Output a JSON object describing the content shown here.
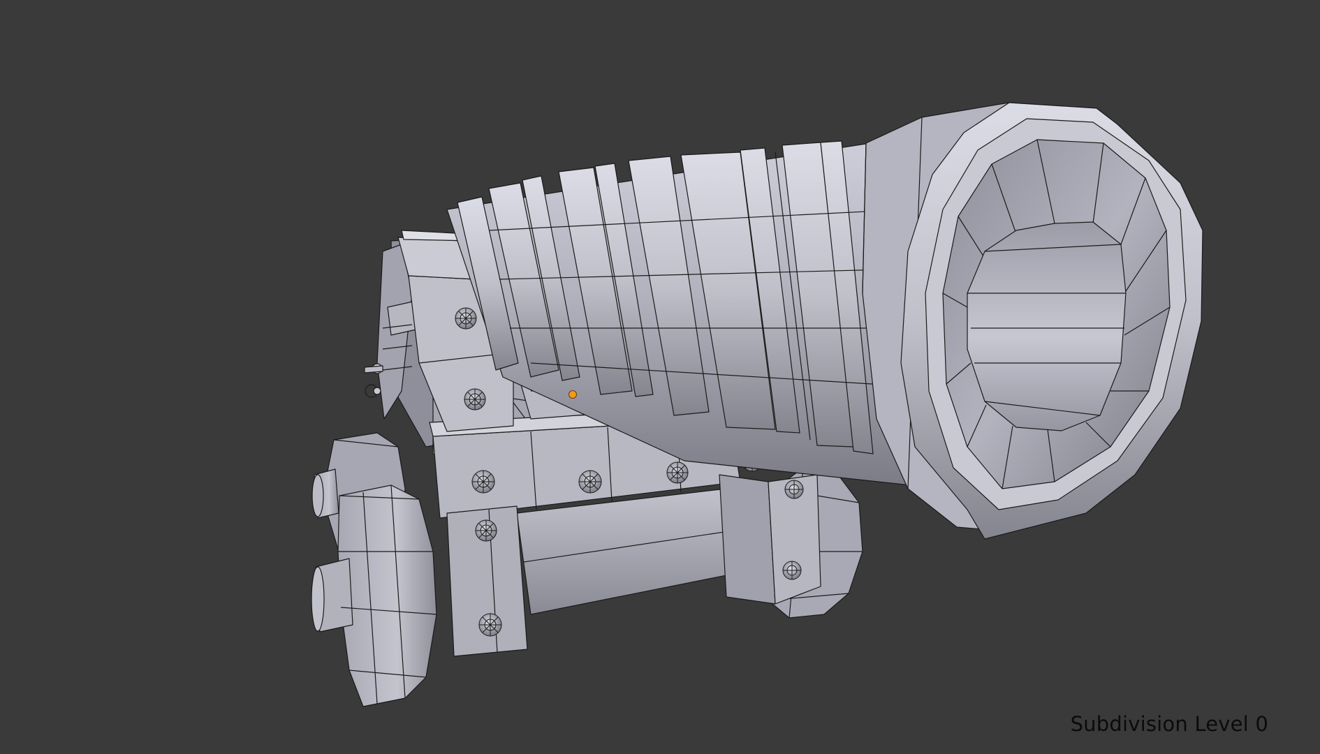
{
  "viewport": {
    "overlay_label": "Subdivision Level 0",
    "background_color": "#3a3a3a",
    "model_color": "#b4b4c0",
    "wire_color": "#1a1a1a",
    "origin_color": "#f39a1e"
  },
  "icons": [
    "object-origin-icon"
  ]
}
